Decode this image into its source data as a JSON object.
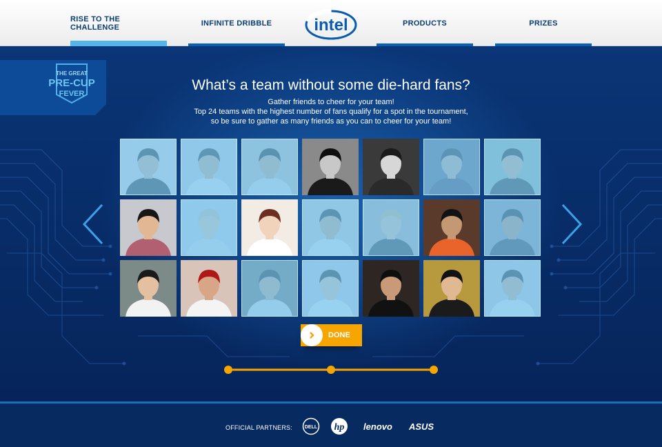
{
  "nav": {
    "items": [
      {
        "label": "RISE TO THE CHALLENGE",
        "active": true
      },
      {
        "label": "INFINITE DRIBBLE",
        "active": false
      },
      {
        "label": "PRODUCTS",
        "active": false
      },
      {
        "label": "PRIZES",
        "active": false
      }
    ],
    "logo_text": "intel"
  },
  "badge": {
    "line1": "THE GREAT",
    "line2": "PRE-CUP",
    "line3": "FEVER"
  },
  "main": {
    "headline": "What’s a team without some die-hard fans?",
    "subtext": [
      "Gather friends to cheer for your team!",
      "Top 24 teams with the highest number of fans qualify for a spot in the tournament,",
      "so be sure to gather as many friends as you can to cheer for your team!"
    ],
    "friends": [
      {
        "selected": false,
        "bg": "#e9e2d8",
        "skin": "#d9b48f",
        "hair": "#1c1c1c",
        "shirt": "#222222"
      },
      {
        "selected": false,
        "bg": "#cfd3d8",
        "skin": "#d6ad88",
        "hair": "#222222",
        "shirt": "#f0f0f0"
      },
      {
        "selected": false,
        "bg": "#c9c2b0",
        "skin": "#d2a982",
        "hair": "#151515",
        "shirt": "#e5e5e5"
      },
      {
        "selected": true,
        "bg": "#8a8a8a",
        "skin": "#c8c8c8",
        "hair": "#0f0f0f",
        "shirt": "#1a1a1a"
      },
      {
        "selected": true,
        "bg": "#3a3a3a",
        "skin": "#d7d7d7",
        "hair": "#1b1b1b",
        "shirt": "#2a2a2a"
      },
      {
        "selected": false,
        "bg": "#5b5f78",
        "skin": "#c9a88c",
        "hair": "#1a1a2a",
        "shirt": "#3a3a55"
      },
      {
        "selected": false,
        "bg": "#9cb7a0",
        "skin": "#d7b08a",
        "hair": "#161616",
        "shirt": "#2a2a2a"
      },
      {
        "selected": true,
        "bg": "#c7c9cf",
        "skin": "#e2b894",
        "hair": "#161616",
        "shirt": "#b06070"
      },
      {
        "selected": false,
        "bg": "#cfd6dd",
        "skin": "#f0cfae",
        "hair": "#d8c7a0",
        "shirt": "#e7e7e7"
      },
      {
        "selected": true,
        "bg": "#f2ece4",
        "skin": "#f1d3bb",
        "hair": "#6b2e20",
        "shirt": "#ffffff"
      },
      {
        "selected": false,
        "bg": "#d4cfc6",
        "skin": "#d2a982",
        "hair": "#1a1a1a",
        "shirt": "#efefef"
      },
      {
        "selected": false,
        "bg": "#b8b0a8",
        "skin": "#e6c09e",
        "hair": "#d4b27a",
        "shirt": "#2a2a2a"
      },
      {
        "selected": true,
        "bg": "#5a3a2a",
        "skin": "#c59874",
        "hair": "#121212",
        "shirt": "#e8642a"
      },
      {
        "selected": false,
        "bg": "#8d9099",
        "skin": "#b98c6a",
        "hair": "#151515",
        "shirt": "#2d2d3a"
      },
      {
        "selected": true,
        "bg": "#7c8a88",
        "skin": "#e5c0a0",
        "hair": "#1a1a1a",
        "shirt": "#f2f2f2"
      },
      {
        "selected": true,
        "bg": "#d8c4b8",
        "skin": "#d9a587",
        "hair": "#b01818",
        "shirt": "#f4f4f4"
      },
      {
        "selected": false,
        "bg": "#6f7060",
        "skin": "#cfa47e",
        "hair": "#161616",
        "shirt": "#e0e0e0"
      },
      {
        "selected": false,
        "bg": "#cbd1d6",
        "skin": "#e8c6a6",
        "hair": "#1a1a1a",
        "shirt": "#f5f5f5"
      },
      {
        "selected": true,
        "bg": "#2e2622",
        "skin": "#c89a77",
        "hair": "#0e0e0e",
        "shirt": "#111111"
      },
      {
        "selected": true,
        "bg": "#b89a3e",
        "skin": "#e0b892",
        "hair": "#121212",
        "shirt": "#1b1b1b"
      },
      {
        "selected": false,
        "bg": "#c9ccd0",
        "skin": "#d8ae88",
        "hair": "#161616",
        "shirt": "#efefef"
      }
    ],
    "done_label": "DONE",
    "progress_steps": 3
  },
  "footer": {
    "partners_label": "OFFICIAL PARTNERS:",
    "partners": [
      {
        "name": "DELL",
        "icon": "dell-logo"
      },
      {
        "name": "hp",
        "icon": "hp-logo"
      },
      {
        "name": "lenovo",
        "icon": "lenovo-logo"
      },
      {
        "name": "ASUS",
        "icon": "asus-logo"
      }
    ]
  },
  "colors": {
    "brand_blue": "#0a3d75",
    "accent_orange": "#f7a500",
    "accent_light_blue": "#55b4e8",
    "background_navy": "#06214f"
  }
}
